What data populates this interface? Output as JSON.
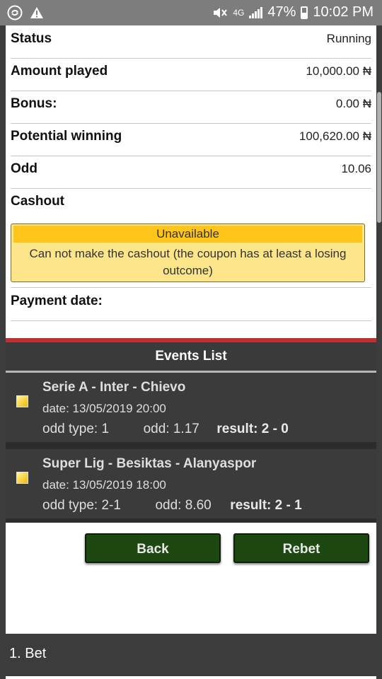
{
  "status_bar": {
    "left_icons": [
      "sync-icon",
      "warning-icon"
    ],
    "network": "4G",
    "battery": "47%",
    "time": "10:02 PM"
  },
  "details": [
    {
      "label": "Status",
      "value": "Running"
    },
    {
      "label": "Amount played",
      "value": "10,000.00 ₦"
    },
    {
      "label": "Bonus:",
      "value": "0.00 ₦"
    },
    {
      "label": "Potential winning",
      "value": "100,620.00 ₦"
    },
    {
      "label": "Odd",
      "value": "10.06"
    }
  ],
  "cashout": {
    "label": "Cashout",
    "status": "Unavailable",
    "message": "Can not make the cashout (the coupon has at least a losing outcome)",
    "status_color": "#ffc51b",
    "box_color": "#fde58a"
  },
  "payment_date": {
    "label": "Payment date:",
    "value": ""
  },
  "events_list": {
    "title": "Events List",
    "accent_color": "#b93131",
    "items": [
      {
        "name": "Serie A - Inter - Chievo",
        "date": "date: 13/05/2019 20:00",
        "odd_type": "odd type: 1",
        "odd": "odd: 1.17",
        "result": "result: 2 - 0"
      },
      {
        "name": "Super Lig - Besiktas - Alanyaspor",
        "date": "date: 13/05/2019 18:00",
        "odd_type": "odd type: 2-1",
        "odd": "odd: 8.60",
        "result": "result: 2 - 1"
      }
    ]
  },
  "buttons": {
    "back": "Back",
    "rebet": "Rebet",
    "color": "#1d4812"
  },
  "bottom_bar": {
    "label": "1. Bet"
  }
}
